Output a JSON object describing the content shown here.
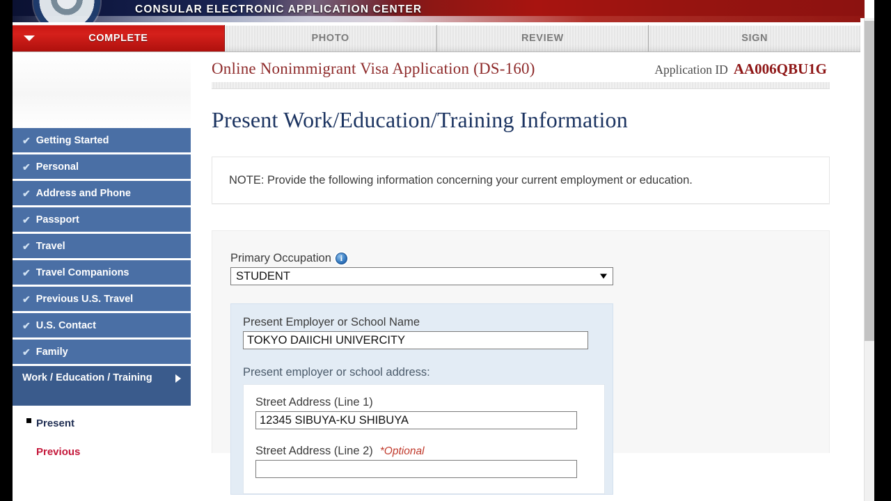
{
  "banner": {
    "title": "CONSULAR ELECTRONIC APPLICATION CENTER",
    "seal_icon": "dos-seal-icon"
  },
  "tabs": [
    {
      "label": "COMPLETE",
      "active": true,
      "caret_icon": "caret-down-icon"
    },
    {
      "label": "PHOTO",
      "active": false
    },
    {
      "label": "REVIEW",
      "active": false
    },
    {
      "label": "SIGN",
      "active": false
    }
  ],
  "sidebar": {
    "items": [
      {
        "label": "Getting Started",
        "check": "✔",
        "complete": true
      },
      {
        "label": "Personal",
        "check": "✔",
        "complete": true
      },
      {
        "label": "Address and Phone",
        "check": "✔",
        "complete": true
      },
      {
        "label": "Passport",
        "check": "✔",
        "complete": true
      },
      {
        "label": "Travel",
        "check": "✔",
        "complete": true
      },
      {
        "label": "Travel Companions",
        "check": "✔",
        "complete": true
      },
      {
        "label": "Previous U.S. Travel",
        "check": "✔",
        "complete": true
      },
      {
        "label": "U.S. Contact",
        "check": "✔",
        "complete": true
      },
      {
        "label": "Family",
        "check": "✔",
        "complete": true
      }
    ],
    "current_item": {
      "label": "Work / Education / Training",
      "arrow_icon": "arrow-right-icon"
    },
    "subitems": [
      {
        "label": "Present",
        "selected": true
      },
      {
        "label": "Previous",
        "selected": false
      }
    ]
  },
  "header": {
    "app_title": "Online Nonimmigrant Visa Application (DS-160)",
    "app_id_label": "Application ID",
    "app_id_value": "AA006QBU1G"
  },
  "main": {
    "page_title": "Present Work/Education/Training Information",
    "note": "NOTE: Provide the following information concerning your current employment or education.",
    "primary_occupation": {
      "label": "Primary Occupation",
      "info_icon": "info-icon",
      "info_glyph": "i",
      "value": "STUDENT",
      "dropdown_icon": "caret-down-icon"
    },
    "employer_name": {
      "label": "Present Employer or School Name",
      "value": "TOKYO DAIICHI UNIVERCITY"
    },
    "address_section_label": "Present employer or school address:",
    "street_line1": {
      "label": "Street Address (Line 1)",
      "value": "12345 SIBUYA-KU SHIBUYA"
    },
    "street_line2": {
      "label": "Street Address (Line 2)",
      "optional": "*Optional"
    }
  },
  "scrollbar": {
    "name": "vertical-scrollbar"
  },
  "colors": {
    "accent_red": "#c91714",
    "nav_blue": "#4a6fa5",
    "nav_blue_active": "#3a5b8c",
    "title_navy": "#1c3461",
    "app_title_maroon": "#8e2a2a",
    "link_crimson": "#c41639",
    "panel_bg": "#f7f7f7",
    "blue_block": "#e3ecf5"
  }
}
